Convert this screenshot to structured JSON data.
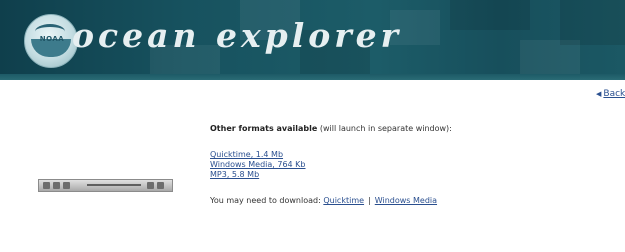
{
  "banner": {
    "site_title": "ocean explorer",
    "logo_text": "NOAA",
    "background_color": "#17525f"
  },
  "nav": {
    "back_label": "Back"
  },
  "formats": {
    "heading_bold": "Other formats available",
    "heading_rest": " (will launch in separate window):",
    "links": [
      "Quicktime, 1.4 Mb",
      "Windows Media, 764 Kb",
      "MP3, 5.8 Mb"
    ]
  },
  "download": {
    "prefix": "You may need to download:",
    "links": [
      "Quicktime",
      "Windows Media"
    ],
    "separator": "|"
  },
  "colors": {
    "link": "#2a4f8f",
    "text": "#333333"
  }
}
